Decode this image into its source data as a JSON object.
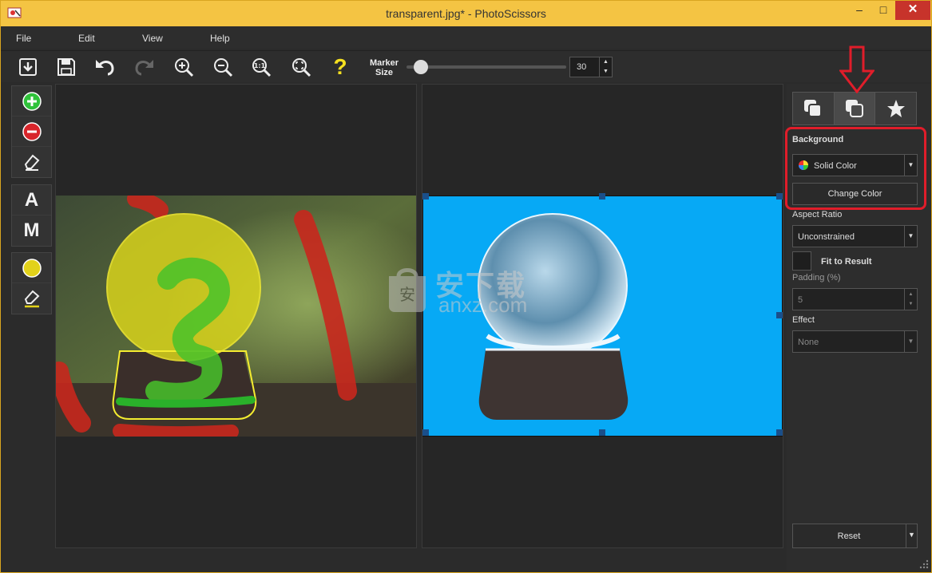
{
  "window": {
    "title": "transparent.jpg* - PhotoScissors",
    "min_glyph": "–",
    "max_glyph": "□",
    "close_glyph": "✕"
  },
  "menu": {
    "items": [
      "File",
      "Edit",
      "View",
      "Help"
    ]
  },
  "toolbar": {
    "buttons": [
      "open-icon",
      "save-icon",
      "undo-icon",
      "redo-icon",
      "zoom-in-icon",
      "zoom-out-icon",
      "actual-size-icon",
      "fit-icon",
      "help-icon"
    ],
    "help_glyph": "?",
    "marker_label_1": "Marker",
    "marker_label_2": "Size",
    "marker_value": "30",
    "marker_slider_fraction": 0.05
  },
  "tools": {
    "auto_letter": "A",
    "manual_letter": "M"
  },
  "watermark": {
    "cn": "安下载",
    "en": "anxz.com"
  },
  "panel": {
    "background_label": "Background",
    "background_type": "Solid Color",
    "change_color_label": "Change Color",
    "aspect_ratio_label": "Aspect Ratio",
    "aspect_ratio_value": "Unconstrained",
    "fit_label": "Fit to Result",
    "padding_label": "Padding (%)",
    "padding_value": "5",
    "effect_label": "Effect",
    "effect_value": "None",
    "reset_label": "Reset"
  },
  "colors": {
    "titlebar": "#f4c443",
    "result_background": "#07a9f5",
    "highlight": "#e01d2a"
  }
}
